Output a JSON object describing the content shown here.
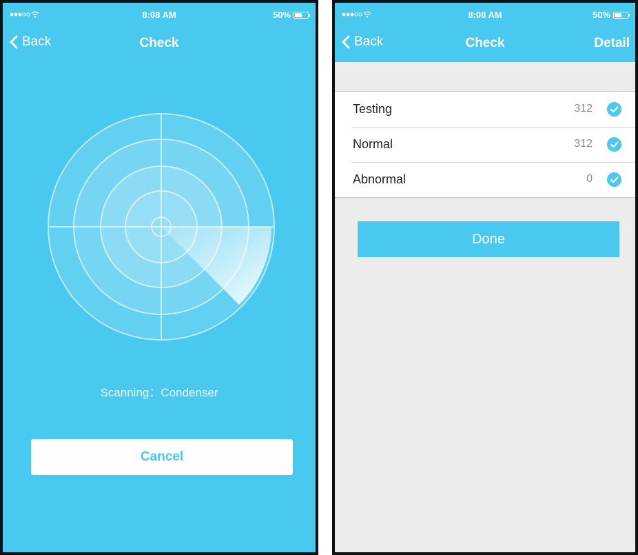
{
  "colors": {
    "accent": "#49c9ef",
    "background_gray": "#ececec",
    "border": "#111111"
  },
  "left_screen": {
    "status": {
      "time": "8:08 AM",
      "battery": "50%"
    },
    "nav": {
      "back_label": "Back",
      "title": "Check"
    },
    "radar": {
      "icon": "radar-scan-icon"
    },
    "scanning": {
      "label": "Scanning",
      "separator": "：",
      "target": "Condenser"
    },
    "cancel_label": "Cancel"
  },
  "right_screen": {
    "status": {
      "time": "8:08 AM",
      "battery": "50%"
    },
    "nav": {
      "back_label": "Back",
      "title": "Check",
      "detail_label": "Detail"
    },
    "results": [
      {
        "label": "Testing",
        "count": "312",
        "icon": "check-circle-icon"
      },
      {
        "label": "Normal",
        "count": "312",
        "icon": "check-circle-icon"
      },
      {
        "label": "Abnormal",
        "count": "0",
        "icon": "check-circle-icon"
      }
    ],
    "done_label": "Done"
  }
}
